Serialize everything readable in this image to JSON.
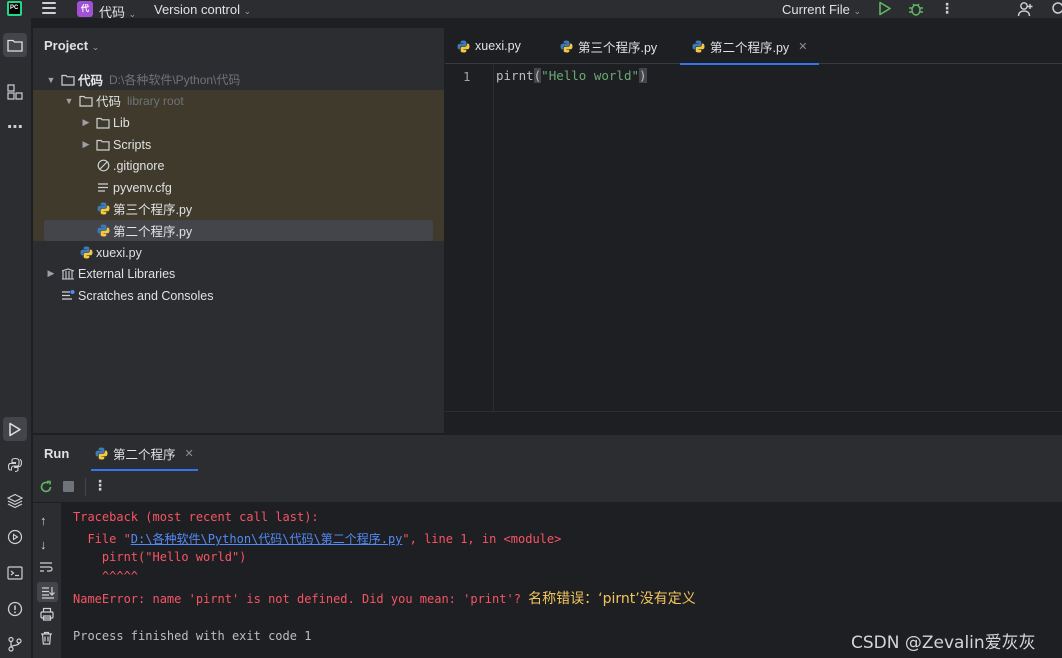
{
  "titlebar": {
    "project_badge": "代",
    "project_name": "代码",
    "version_control": "Version control",
    "run_config": "Current File"
  },
  "project_panel": {
    "header": "Project",
    "tree": [
      {
        "label": "代码",
        "hint": "D:\\各种软件\\Python\\代码",
        "icon": "folder-icon"
      },
      {
        "label": "代码",
        "hint": "library root",
        "icon": "folder-icon"
      },
      {
        "label": "Lib",
        "hint": "",
        "icon": "folder-icon"
      },
      {
        "label": "Scripts",
        "hint": "",
        "icon": "folder-icon"
      },
      {
        "label": ".gitignore",
        "hint": "",
        "icon": "ignored-file-icon"
      },
      {
        "label": "pyvenv.cfg",
        "hint": "",
        "icon": "text-file-icon"
      },
      {
        "label": "第三个程序.py",
        "hint": "",
        "icon": "python-file-icon"
      },
      {
        "label": "第二个程序.py",
        "hint": "",
        "icon": "python-file-icon"
      },
      {
        "label": "xuexi.py",
        "hint": "",
        "icon": "python-file-icon"
      },
      {
        "label": "External Libraries",
        "hint": "",
        "icon": "library-icon"
      },
      {
        "label": "Scratches and Consoles",
        "hint": "",
        "icon": "scratches-icon"
      }
    ]
  },
  "editor": {
    "tabs": [
      {
        "label": "xuexi.py"
      },
      {
        "label": "第三个程序.py"
      },
      {
        "label": "第二个程序.py"
      }
    ],
    "line_number": "1",
    "code": {
      "func": "pirnt",
      "open": "(",
      "string": "\"Hello world\"",
      "close": ")"
    }
  },
  "run_panel": {
    "title": "Run",
    "tab": "第二个程序",
    "console": {
      "l1": "Traceback (most recent call last):",
      "l2_prefix": "  File \"",
      "l2_link": "D:\\各种软件\\Python\\代码\\代码\\第二个程序.py",
      "l2_suffix": "\", line 1, in <module>",
      "l3": "    pirnt(\"Hello world\")",
      "l4": "    ^^^^^",
      "l5": "NameError: name 'pirnt' is not defined. Did you mean: 'print'?",
      "l5_note": "名称错误：‘pirnt’没有定义",
      "l6": "Process finished with exit code 1"
    }
  },
  "watermark": "CSDN @Zevalin爱灰灰",
  "colors": {
    "accent": "#3574f0",
    "error": "#f75464",
    "string": "#6aab73",
    "note": "#f2c55c",
    "run_green": "#5fb865"
  }
}
